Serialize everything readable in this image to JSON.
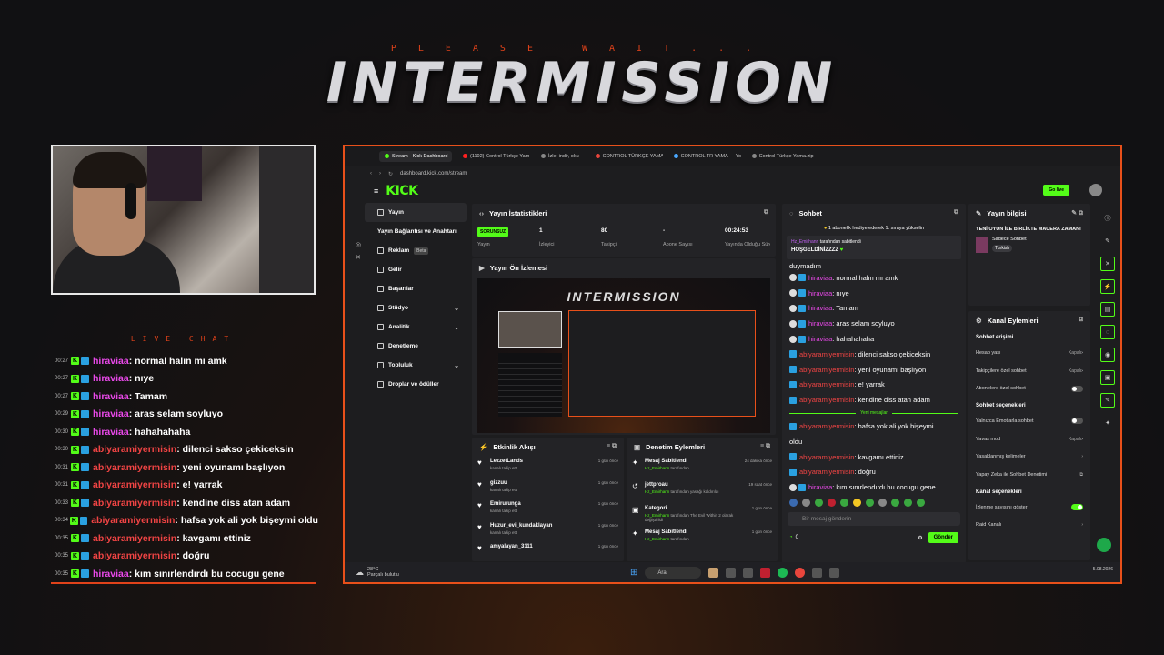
{
  "overlay": {
    "please_wait": "PLEASE WAIT...",
    "title": "INTERMISSION",
    "live_chat_title": "LIVE CHAT",
    "chat": [
      {
        "time": "00:27",
        "user": "hiraviaa",
        "color": "purple",
        "msg": ": normal halın mı amk"
      },
      {
        "time": "00:27",
        "user": "hiraviaa",
        "color": "purple",
        "msg": ": nıye"
      },
      {
        "time": "00:27",
        "user": "hiraviaa",
        "color": "purple",
        "msg": ": Tamam"
      },
      {
        "time": "00:29",
        "user": "hiraviaa",
        "color": "purple",
        "msg": ": aras selam soyluyo"
      },
      {
        "time": "00:30",
        "user": "hiraviaa",
        "color": "purple",
        "msg": ": hahahahaha"
      },
      {
        "time": "00:30",
        "user": "abiyaramiyermisin",
        "color": "red",
        "msg": ": dilenci sakso çekiceksin"
      },
      {
        "time": "00:31",
        "user": "abiyaramiyermisin",
        "color": "red",
        "msg": ": yeni oyunamı başlıyon"
      },
      {
        "time": "00:31",
        "user": "abiyaramiyermisin",
        "color": "red",
        "msg": ": e! yarrak"
      },
      {
        "time": "00:33",
        "user": "abiyaramiyermisin",
        "color": "red",
        "msg": ": kendine diss atan adam"
      },
      {
        "time": "00:34",
        "user": "abiyaramiyermisin",
        "color": "red",
        "msg": ": hafsa yok ali yok bişeymi oldu"
      },
      {
        "time": "00:35",
        "user": "abiyaramiyermisin",
        "color": "red",
        "msg": ": kavgamı ettiniz"
      },
      {
        "time": "00:35",
        "user": "abiyaramiyermisin",
        "color": "red",
        "msg": ": doğru"
      },
      {
        "time": "00:35",
        "user": "hiraviaa",
        "color": "purple",
        "msg": ": kım sınırlendırdı bu cocugu gene"
      }
    ]
  },
  "browser": {
    "tabs": [
      "Stream - Kick Dashboard",
      "(1102) Control Türkçe Yam",
      "İzle, indir, oku",
      "CONTROL TÜRKÇE YAMA",
      "CONTROL TR YAMA — Yo",
      "Control Türkçe Yama.zip"
    ],
    "url": "dashboard.kick.com/stream"
  },
  "kick": {
    "logo": "KICK",
    "go_live": "Go live",
    "sidebar": [
      {
        "label": "Yayın"
      },
      {
        "label": "Yayın Bağlantısı ve Anahtarı"
      },
      {
        "label": "Reklam",
        "badge": "Beta"
      },
      {
        "label": "Gelir"
      },
      {
        "label": "Başarılar"
      },
      {
        "label": "Stüdyo"
      },
      {
        "label": "Analitik"
      },
      {
        "label": "Denetleme"
      },
      {
        "label": "Topluluk"
      },
      {
        "label": "Droplar ve ödüller"
      }
    ],
    "stats": {
      "title": "Yayın İstatistikleri",
      "status": "SORUNSUZ",
      "status_label": "Yayın",
      "viewers": "1",
      "viewers_label": "İzleyici",
      "followers": "80",
      "followers_label": "Takipçi",
      "subs": "-",
      "subs_label": "Abone Sayısı",
      "duration": "00:24:53",
      "duration_label": "Yayında Olduğu Süre"
    },
    "preview": {
      "title": "Yayın Ön İzlemesi",
      "overlay_text": "INTERMISSION"
    },
    "activity": {
      "title": "Etkinlik Akışı",
      "items": [
        {
          "name": "LezzetLands",
          "sub": "kanalı takip etti",
          "time": "1 gün önce"
        },
        {
          "name": "gizzuu",
          "sub": "kanalı takip etti",
          "time": "1 gün önce"
        },
        {
          "name": "Emirurunga",
          "sub": "kanalı takip etti",
          "time": "1 gün önce"
        },
        {
          "name": "Huzur_evi_kundaklayan",
          "sub": "kanalı takip etti",
          "time": "1 gün önce"
        },
        {
          "name": "amyalayan_3111",
          "sub": "",
          "time": "1 gün önce"
        }
      ]
    },
    "moderation": {
      "title": "Denetim Eylemleri",
      "items": [
        {
          "name": "Mesaj Sabitlendi",
          "by": "Hz_Emirhann",
          "rest": "tarafından",
          "time": "24 dakika önce"
        },
        {
          "name": "jettproau",
          "by": "Hz_Emirhann",
          "rest": "tarafından yasağı kaldırıldı",
          "time": "19 saat önce"
        },
        {
          "name": "Kategori",
          "by": "Hz_Emirhann",
          "rest": "tarafından The Evil Within 2 olarak değiştirildi",
          "time": "1 gün önce"
        },
        {
          "name": "Mesaj Sabitlendi",
          "by": "Hz_Emirhann",
          "rest": "tarafından",
          "time": "1 gün önce"
        }
      ]
    },
    "chat": {
      "title": "Sohbet",
      "gift": "1 abonelik hediye ederek 1. sıraya yükselin",
      "pinned_by": "Hz_Emirhann",
      "pinned_suffix": "tarafından sabitlendi",
      "pinned_msg": "HOŞGELDİNİZZZZ",
      "cut_line": "duymadım",
      "messages": [
        {
          "user": "hiraviaa",
          "color": "purple",
          "msg": ": normal halın mı amk"
        },
        {
          "user": "hiraviaa",
          "color": "purple",
          "msg": ": nıye"
        },
        {
          "user": "hiraviaa",
          "color": "purple",
          "msg": ": Tamam"
        },
        {
          "user": "hiraviaa",
          "color": "purple",
          "msg": ": aras selam soyluyo"
        },
        {
          "user": "hiraviaa",
          "color": "purple",
          "msg": ": hahahahaha"
        },
        {
          "user": "abiyaramiyermisin",
          "color": "red",
          "msg": ": dilenci sakso çekiceksin"
        },
        {
          "user": "abiyaramiyermisin",
          "color": "red",
          "msg": ": yeni oyunamı başlıyon"
        },
        {
          "user": "abiyaramiyermisin",
          "color": "red",
          "msg": ": e! yarrak"
        },
        {
          "user": "abiyaramiyermisin",
          "color": "red",
          "msg": ": kendine diss atan adam"
        }
      ],
      "new_messages": "Yeni mesajlar",
      "messages2": [
        {
          "user": "abiyaramiyermisin",
          "color": "red",
          "msg": ": hafsa yok ali yok bişeymi"
        },
        {
          "user": "",
          "color": "red",
          "msg": "oldu"
        },
        {
          "user": "abiyaramiyermisin",
          "color": "red",
          "msg": ": kavgamı ettiniz"
        },
        {
          "user": "abiyaramiyermisin",
          "color": "red",
          "msg": ": doğru"
        },
        {
          "user": "hiraviaa",
          "color": "purple",
          "msg": ": kım sınırlendırdı bu cocugu gene"
        }
      ],
      "input_placeholder": "Bir mesaj gönderin",
      "points": "0",
      "send": "Gönder"
    },
    "info": {
      "title": "Yayın bilgisi",
      "stream_title": "YENİ OYUN İLE BİRLİKTE MACERA ZAMANI",
      "category": "Sadece Sohbet",
      "tag": "Turkish"
    },
    "actions": {
      "title": "Kanal Eylemleri",
      "access_h": "Sohbet erişimi",
      "rows1": [
        {
          "label": "Hesap yaşı",
          "value": "Kapalı",
          "type": "select"
        },
        {
          "label": "Takipçilere özel sohbet",
          "value": "Kapalı",
          "type": "select"
        },
        {
          "label": "Abonelere özel sohbet",
          "type": "toggle",
          "on": false
        }
      ],
      "options_h": "Sohbet seçenekleri",
      "rows2": [
        {
          "label": "Yalnızca Emotlarla sohbet",
          "type": "toggle",
          "on": false
        },
        {
          "label": "Yavaş mod",
          "value": "Kapalı",
          "type": "select"
        },
        {
          "label": "Yasaklanmış kelimeler",
          "type": "link"
        },
        {
          "label": "Yapay Zeka ile Sohbet Denetimi",
          "type": "ext"
        }
      ],
      "channel_h": "Kanal seçenekleri",
      "rows3": [
        {
          "label": "İzlenme sayısını göster",
          "type": "toggle",
          "on": true
        },
        {
          "label": "Raid Kanalı",
          "type": "link"
        }
      ]
    }
  },
  "taskbar": {
    "temp": "28°C",
    "weather": "Parçalı bulutlu",
    "search": "Ara",
    "time": "",
    "date": "5.08.2026"
  },
  "colors": {
    "kick_green": "#53fc18",
    "accent_orange": "#e8501a",
    "purple_name": "#ea49ea",
    "red_name": "#f04444"
  }
}
